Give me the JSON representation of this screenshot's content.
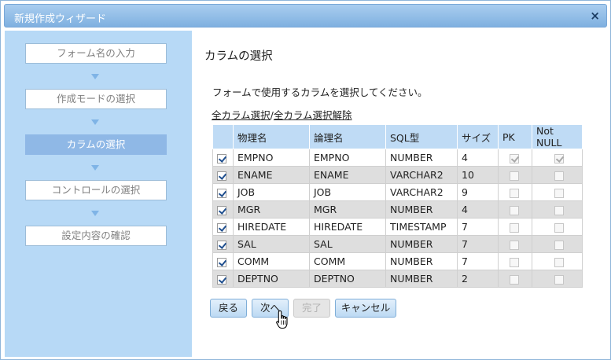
{
  "window": {
    "title": "新規作成ウィザード",
    "close_glyph": "×"
  },
  "steps": [
    {
      "label": "フォーム名の入力",
      "active": false
    },
    {
      "label": "作成モードの選択",
      "active": false
    },
    {
      "label": "カラムの選択",
      "active": true
    },
    {
      "label": "コントロールの選択",
      "active": false
    },
    {
      "label": "設定内容の確認",
      "active": false
    }
  ],
  "main": {
    "title": "カラムの選択",
    "instruction": "フォームで使用するカラムを選択してください。",
    "select_all": "全カラム選択",
    "separator": "/",
    "deselect_all": "全カラム選択解除"
  },
  "table": {
    "headers": [
      "",
      "物理名",
      "論理名",
      "SQL型",
      "サイズ",
      "PK",
      "Not NULL"
    ],
    "rows": [
      {
        "selected": true,
        "physical": "EMPNO",
        "logical": "EMPNO",
        "sql_type": "NUMBER",
        "size": "4",
        "pk": true,
        "not_null": true
      },
      {
        "selected": true,
        "physical": "ENAME",
        "logical": "ENAME",
        "sql_type": "VARCHAR2",
        "size": "10",
        "pk": false,
        "not_null": false
      },
      {
        "selected": true,
        "physical": "JOB",
        "logical": "JOB",
        "sql_type": "VARCHAR2",
        "size": "9",
        "pk": false,
        "not_null": false
      },
      {
        "selected": true,
        "physical": "MGR",
        "logical": "MGR",
        "sql_type": "NUMBER",
        "size": "4",
        "pk": false,
        "not_null": false
      },
      {
        "selected": true,
        "physical": "HIREDATE",
        "logical": "HIREDATE",
        "sql_type": "TIMESTAMP",
        "size": "7",
        "pk": false,
        "not_null": false
      },
      {
        "selected": true,
        "physical": "SAL",
        "logical": "SAL",
        "sql_type": "NUMBER",
        "size": "7",
        "pk": false,
        "not_null": false
      },
      {
        "selected": true,
        "physical": "COMM",
        "logical": "COMM",
        "sql_type": "NUMBER",
        "size": "7",
        "pk": false,
        "not_null": false
      },
      {
        "selected": true,
        "physical": "DEPTNO",
        "logical": "DEPTNO",
        "sql_type": "NUMBER",
        "size": "2",
        "pk": false,
        "not_null": false
      }
    ]
  },
  "buttons": {
    "back": "戻る",
    "next": "次へ",
    "finish": "完了",
    "cancel": "キャンセル"
  },
  "colors": {
    "sidebar": "#b7d9f6",
    "active_step": "#8fb8e6",
    "header": "#bfdbf5",
    "titlebar": "#8fbde8"
  }
}
